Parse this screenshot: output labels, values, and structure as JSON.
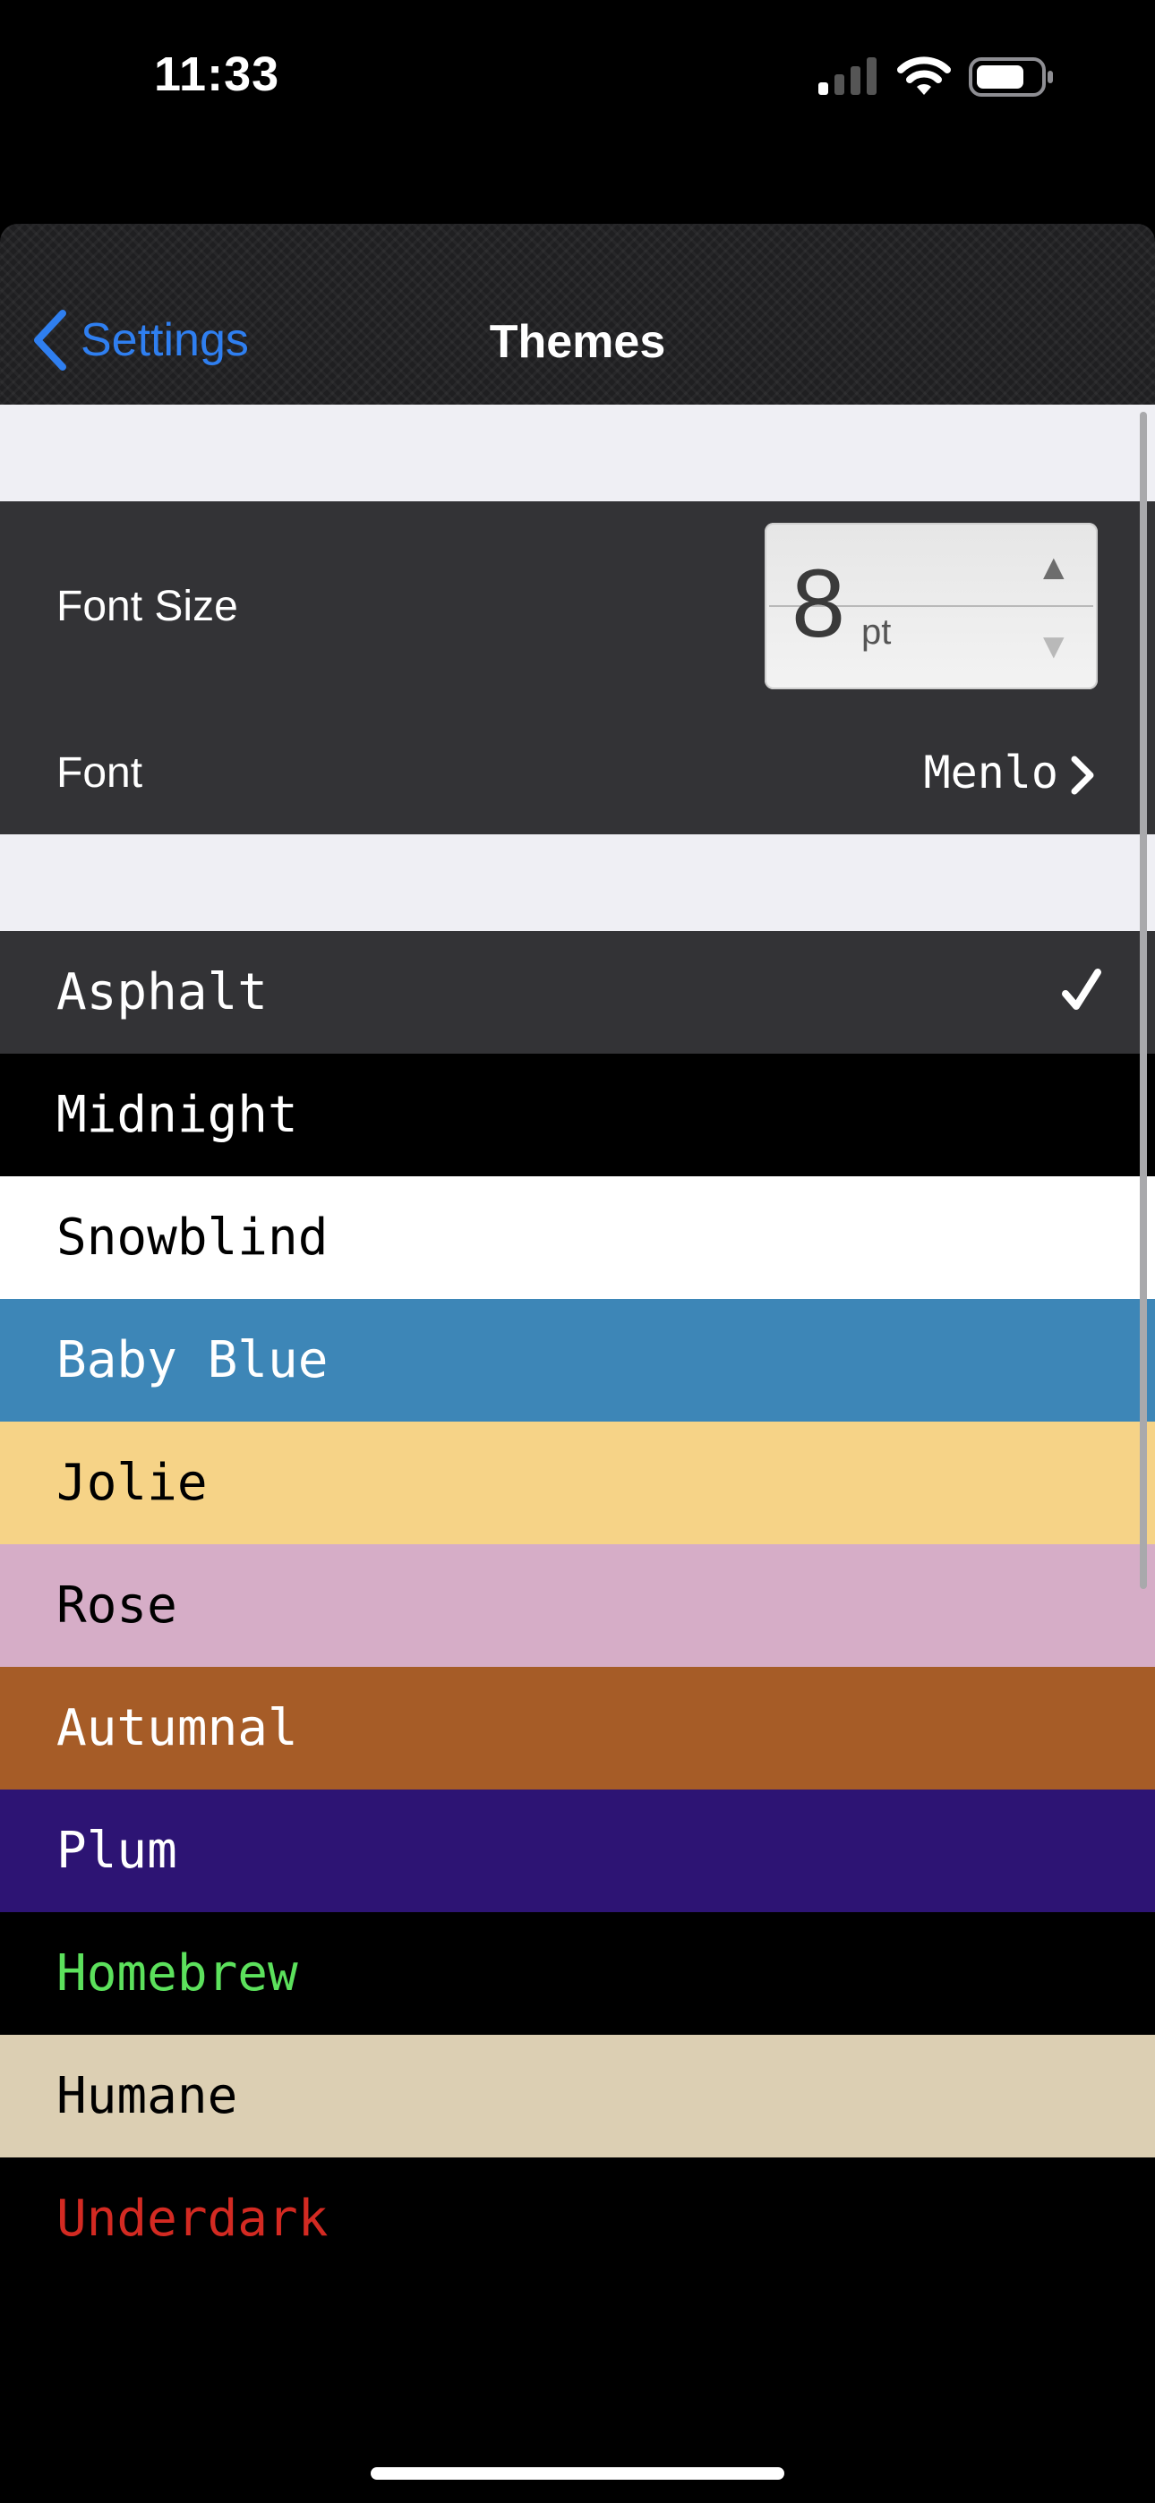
{
  "status_bar": {
    "time": "11:33"
  },
  "nav": {
    "back_label": "Settings",
    "title": "Themes"
  },
  "font_size": {
    "label": "Font Size",
    "value": "8",
    "unit": "pt"
  },
  "font": {
    "label": "Font",
    "value": "Menlo"
  },
  "themes": [
    {
      "name": "Asphalt",
      "bg": "#333336",
      "fg": "#ffffff",
      "selected": true
    },
    {
      "name": "Midnight",
      "bg": "#000000",
      "fg": "#ffffff"
    },
    {
      "name": "Snowblind",
      "bg": "#ffffff",
      "fg": "#000000"
    },
    {
      "name": "Baby Blue",
      "bg": "#3d86b7",
      "fg": "#ffffff"
    },
    {
      "name": "Jolie",
      "bg": "#f6d387",
      "fg": "#000000"
    },
    {
      "name": "Rose",
      "bg": "#d6adc7",
      "fg": "#000000"
    },
    {
      "name": "Autumnal",
      "bg": "#a65c27",
      "fg": "#ffffff"
    },
    {
      "name": "Plum",
      "bg": "#2d1474",
      "fg": "#ffffff"
    },
    {
      "name": "Homebrew",
      "bg": "#000000",
      "fg": "#5ce15c"
    },
    {
      "name": "Humane",
      "bg": "#dccfb3",
      "fg": "#000000"
    },
    {
      "name": "Underdark",
      "bg": "#000000",
      "fg": "#d32a22"
    }
  ],
  "colors": {
    "accent": "#2f7ff0",
    "group_bg": "#333336",
    "section_gap": "#efeff4"
  }
}
